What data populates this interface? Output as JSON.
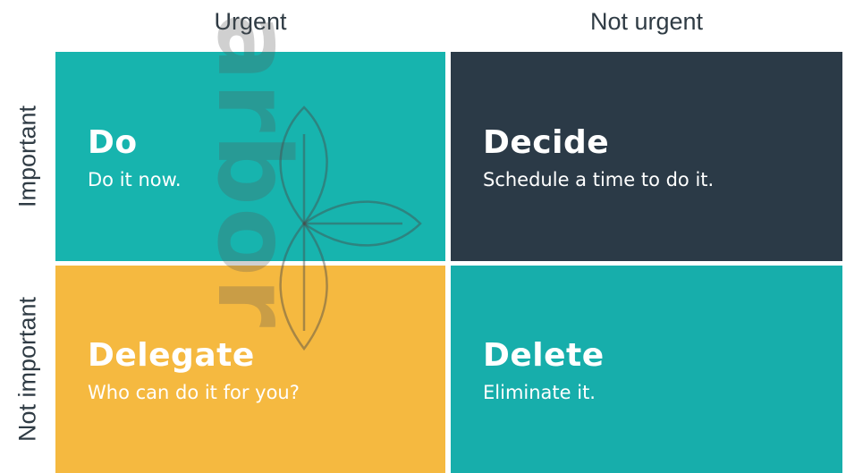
{
  "columns": {
    "urgent": "Urgent",
    "not_urgent": "Not urgent"
  },
  "rows": {
    "important": "Important",
    "not_important": "Not important"
  },
  "quadrants": {
    "do": {
      "title": "Do",
      "subtitle": "Do it now.",
      "color": "#17b4ae"
    },
    "decide": {
      "title": "Decide",
      "subtitle": "Schedule a time to do it.",
      "color": "#2b3a47"
    },
    "delegate": {
      "title": "Delegate",
      "subtitle": "Who can do it for you?",
      "color": "#f5b940"
    },
    "delete": {
      "title": "Delete",
      "subtitle": "Eliminate it.",
      "color": "#17aeab"
    }
  },
  "watermark": {
    "text": "arbor",
    "icon": "leaf-logo-icon"
  }
}
